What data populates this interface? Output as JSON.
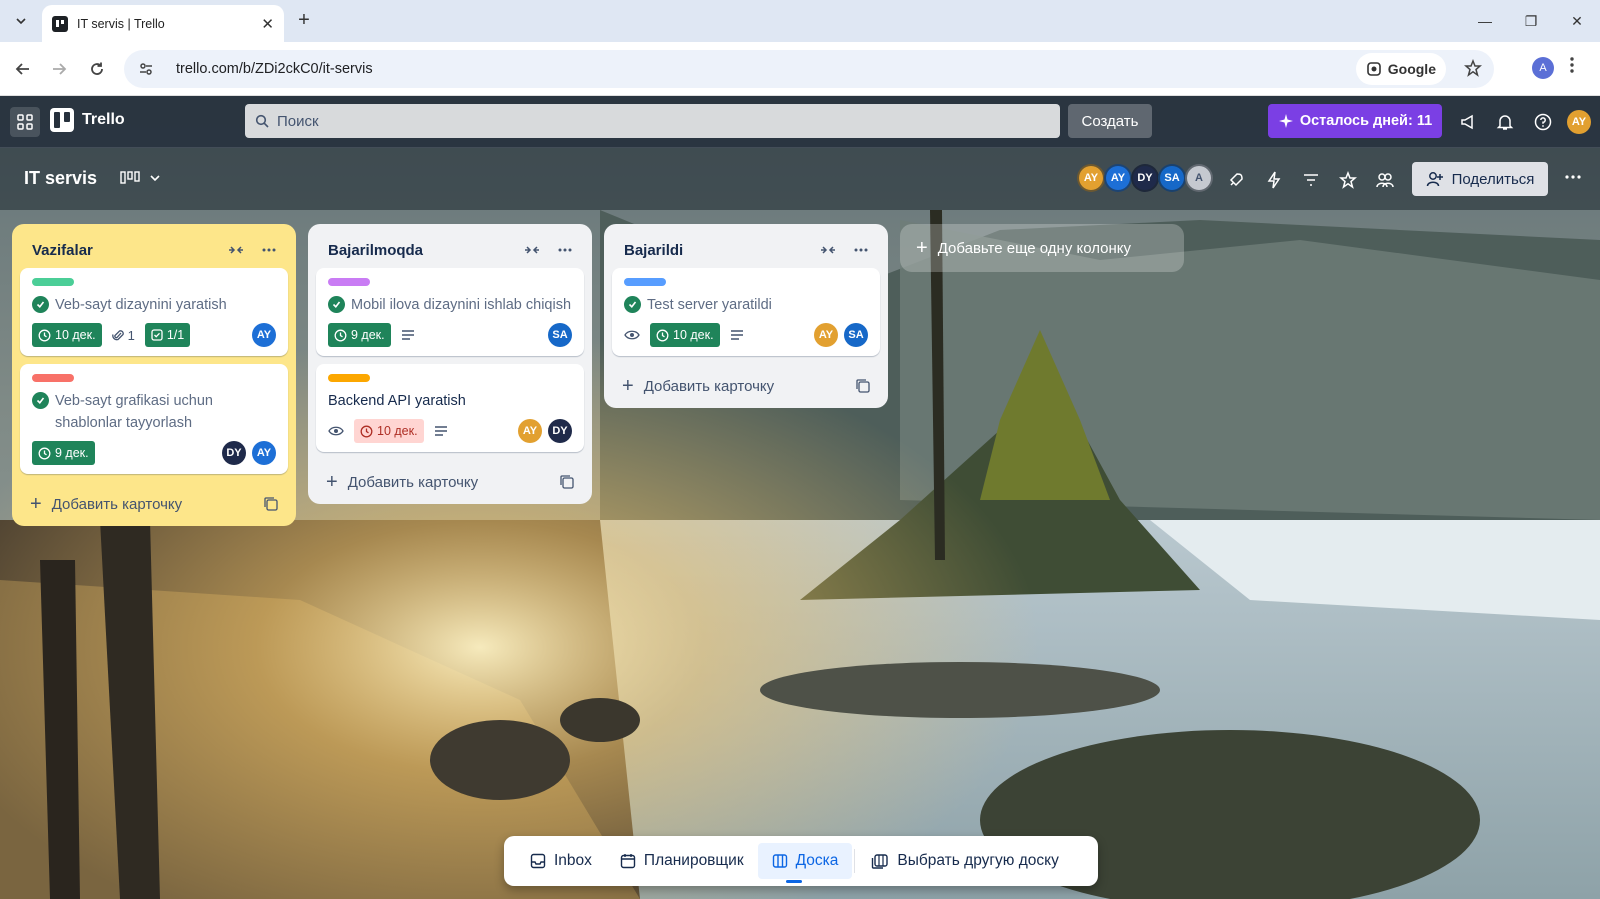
{
  "browser": {
    "tab_title": "IT servis | Trello",
    "url": "trello.com/b/ZDi2ckC0/it-servis",
    "search_chip": "Google",
    "profile_initial": "A"
  },
  "header": {
    "logo": "Trello",
    "search_placeholder": "Поиск",
    "create_label": "Создать",
    "trial_label": "Осталось дней: 11",
    "user_initials": "AY"
  },
  "board": {
    "title": "IT servis",
    "share_label": "Поделиться",
    "members": [
      {
        "initials": "AY",
        "color": "#e2a030"
      },
      {
        "initials": "AY",
        "color": "#1d6fd6"
      },
      {
        "initials": "DY",
        "color": "#1f2a4a"
      },
      {
        "initials": "SA",
        "color": "#1668c8"
      },
      {
        "initials": "A",
        "color": "#c5c9d0"
      }
    ]
  },
  "lists": [
    {
      "title": "Vazifalar",
      "bg": "#fde68a",
      "add_card": "Добавить карточку",
      "cards": [
        {
          "label_color": "#4bce97",
          "title": "Veb-sayt dizaynini yaratish",
          "done": true,
          "due": "10 дек.",
          "attachments": "1",
          "checklist": "1/1",
          "members": [
            "AY"
          ]
        },
        {
          "label_color": "#f87168",
          "title": "Veb-sayt grafikasi uchun shablonlar tayyorlash",
          "done": true,
          "due": "9 дек.",
          "members": [
            "DY",
            "AY"
          ]
        }
      ]
    },
    {
      "title": "Bajarilmoqda",
      "bg": "#f1f2f4",
      "add_card": "Добавить карточку",
      "cards": [
        {
          "label_color": "#c97cf4",
          "title": "Mobil ilova dizaynini ishlab chiqish",
          "done": true,
          "due": "9 дек.",
          "members": [
            "SA"
          ]
        },
        {
          "label_color": "#fca700",
          "title": "Backend API yaratish",
          "done": false,
          "due": "10 дек.",
          "members": [
            "AY",
            "DY"
          ]
        }
      ]
    },
    {
      "title": "Bajarildi",
      "bg": "#f1f2f4",
      "add_card": "Добавить карточку",
      "cards": [
        {
          "label_color": "#579dff",
          "title": "Test server yaratildi",
          "done": true,
          "due": "10 дек.",
          "members": [
            "AY",
            "SA"
          ]
        }
      ]
    }
  ],
  "add_column": "Добавьте еще одну колонку",
  "switcher": {
    "inbox": "Inbox",
    "planner": "Планировщик",
    "board": "Доска",
    "switch_board": "Выбрать другую доску"
  },
  "colors": {
    "AY_orange": "#e2a030",
    "AY_blue": "#1d6fd6",
    "DY": "#1f2a4a",
    "SA": "#1668c8",
    "accent": "#0c66e4",
    "done_green": "#1f845a",
    "trial_purple": "#7b3fe4"
  },
  "icons": [
    "apps-grid-icon",
    "search-icon",
    "megaphone-icon",
    "bell-icon",
    "help-icon",
    "board-view-icon",
    "rocket-icon",
    "lightning-icon",
    "filter-icon",
    "star-icon",
    "group-icon",
    "share-person-icon",
    "more-icon",
    "collapse-icon",
    "clock-icon",
    "paperclip-icon",
    "checklist-icon",
    "description-icon",
    "eye-icon",
    "template-icon",
    "inbox-icon",
    "calendar-icon",
    "board-icon"
  ]
}
